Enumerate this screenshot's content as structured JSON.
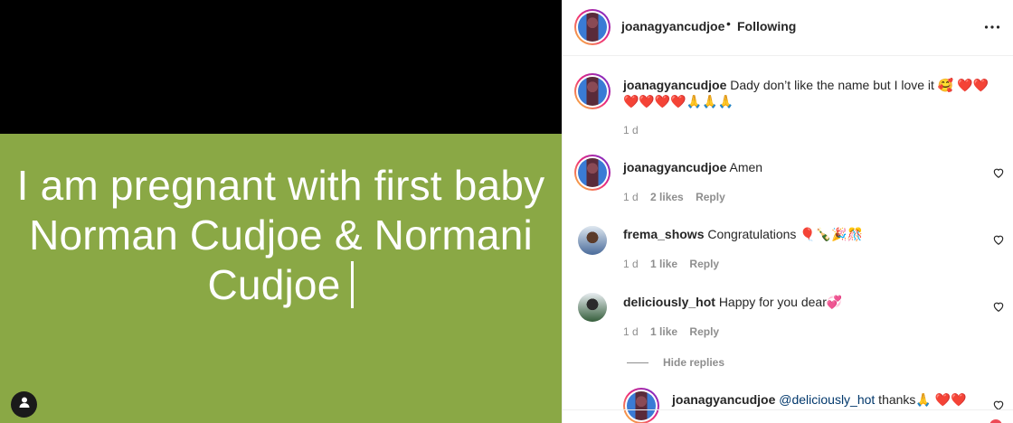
{
  "post": {
    "caption": "I am pregnant with first baby Norman Cudjoe & Normani Cudjoe",
    "background_color": "#8aa845"
  },
  "header": {
    "username": "joanagyancudjoe",
    "separator": "•",
    "follow_status": "Following",
    "more_icon": "more-horizontal-icon"
  },
  "comments": [
    {
      "username": "joanagyancudjoe",
      "text": "Dady don’t like the name but I love it 🥰 ❤️❤️❤️❤️❤️❤️🙏🙏🙏",
      "time": "1 d"
    },
    {
      "username": "joanagyancudjoe",
      "text": "Amen",
      "time": "1 d",
      "likes": "2 likes",
      "reply": "Reply"
    },
    {
      "username": "frema_shows",
      "text": "Congratulations 🎈🍾🎉🎊",
      "time": "1 d",
      "likes": "1 like",
      "reply": "Reply"
    },
    {
      "username": "deliciously_hot",
      "text": "Happy for you dear💞",
      "time": "1 d",
      "likes": "1 like",
      "reply": "Reply"
    }
  ],
  "hide_replies": "Hide replies",
  "reply": {
    "username": "joanagyancudjoe",
    "mention": "@deliciously_hot",
    "text": " thanks🙏 ❤️❤️"
  },
  "colors": {
    "meta": "#8e8e8e",
    "mention": "#00376b",
    "divider": "#efefef"
  }
}
